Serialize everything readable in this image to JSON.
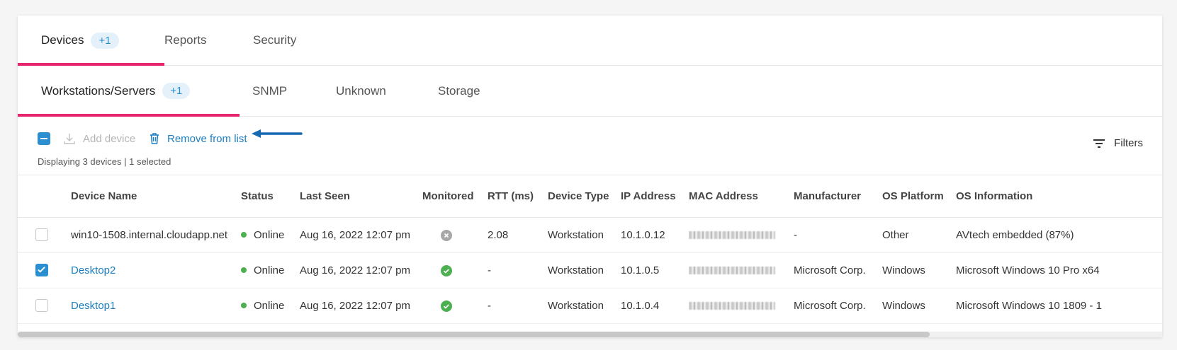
{
  "tabs": [
    {
      "label": "Devices",
      "badge": "+1"
    },
    {
      "label": "Reports"
    },
    {
      "label": "Security"
    }
  ],
  "subtabs": [
    {
      "label": "Workstations/Servers",
      "badge": "+1"
    },
    {
      "label": "SNMP"
    },
    {
      "label": "Unknown"
    },
    {
      "label": "Storage"
    }
  ],
  "toolbar": {
    "add_device": "Add device",
    "remove_from_list": "Remove from list",
    "count_text": "Displaying 3 devices | 1 selected",
    "filters": "Filters"
  },
  "table": {
    "columns": [
      "Device Name",
      "Status",
      "Last Seen",
      "Monitored",
      "RTT (ms)",
      "Device Type",
      "IP Address",
      "MAC Address",
      "Manufacturer",
      "OS Platform",
      "OS Information"
    ],
    "rows": [
      {
        "checked": false,
        "name": "win10-1508.internal.cloudapp.net",
        "name_link": false,
        "status": "Online",
        "last_seen": "Aug 16, 2022 12:07 pm",
        "monitored": false,
        "rtt": "2.08",
        "type": "Workstation",
        "ip": "10.1.0.12",
        "manufacturer": "-",
        "os_platform": "Other",
        "os_info": "AVtech embedded (87%)"
      },
      {
        "checked": true,
        "name": "Desktop2",
        "name_link": true,
        "status": "Online",
        "last_seen": "Aug 16, 2022 12:07 pm",
        "monitored": true,
        "rtt": "-",
        "type": "Workstation",
        "ip": "10.1.0.5",
        "manufacturer": "Microsoft Corp.",
        "os_platform": "Windows",
        "os_info": "Microsoft Windows 10 Pro x64"
      },
      {
        "checked": false,
        "name": "Desktop1",
        "name_link": true,
        "status": "Online",
        "last_seen": "Aug 16, 2022 12:07 pm",
        "monitored": true,
        "rtt": "-",
        "type": "Workstation",
        "ip": "10.1.0.4",
        "manufacturer": "Microsoft Corp.",
        "os_platform": "Windows",
        "os_info": "Microsoft Windows 10 1809 - 1"
      }
    ]
  },
  "colors": {
    "accent": "#e6246e",
    "link": "#1d7fc1",
    "online": "#4caf50"
  },
  "icons": [
    "download-icon",
    "trash-icon",
    "filter-icon",
    "check-icon",
    "x-icon",
    "arrow-left-icon"
  ]
}
